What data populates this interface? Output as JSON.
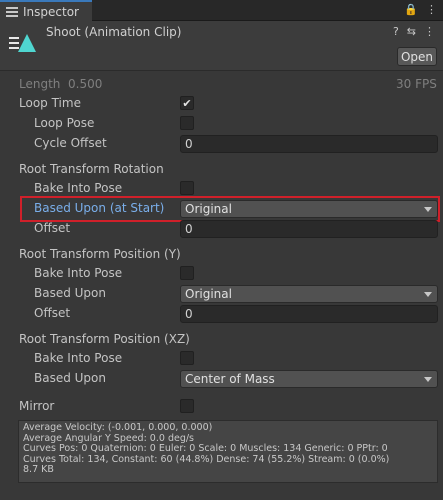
{
  "tab": {
    "label": "Inspector",
    "lock_glyph": "🔒",
    "menu_glyph": "⋮"
  },
  "header": {
    "title": "Shoot (Animation Clip)",
    "help_glyph": "?",
    "settings_glyph": "⇆",
    "menu_glyph": "⋮",
    "open_label": "Open"
  },
  "clip": {
    "length_label": "Length",
    "length_value": "0.500",
    "fps": "30 FPS"
  },
  "loop_time": {
    "label": "Loop Time",
    "checked": true,
    "check_glyph": "✔"
  },
  "loop_pose": {
    "label": "Loop Pose"
  },
  "cycle_offset": {
    "label": "Cycle Offset",
    "value": "0"
  },
  "root_rotation": {
    "section_label": "Root Transform Rotation",
    "bake_label": "Bake Into Pose",
    "based_upon_label": "Based Upon (at Start)",
    "based_upon_value": "Original",
    "offset_label": "Offset",
    "offset_value": "0"
  },
  "root_position_y": {
    "section_label": "Root Transform Position (Y)",
    "bake_label": "Bake Into Pose",
    "based_upon_label": "Based Upon",
    "based_upon_value": "Original",
    "offset_label": "Offset",
    "offset_value": "0"
  },
  "root_position_xz": {
    "section_label": "Root Transform Position (XZ)",
    "bake_label": "Bake Into Pose",
    "based_upon_label": "Based Upon",
    "based_upon_value": "Center of Mass"
  },
  "mirror": {
    "label": "Mirror"
  },
  "stats": {
    "line1": "Average Velocity: (-0.001, 0.000, 0.000)",
    "line2": "Average Angular Y Speed: 0.0 deg/s",
    "line3": "Curves Pos: 0 Quaternion: 0 Euler: 0 Scale: 0 Muscles: 134 Generic: 0 PPtr: 0",
    "line4": "Curves Total: 134, Constant: 60 (44.8%) Dense: 74 (55.2%) Stream: 0 (0.0%)",
    "line5": "8.7 KB"
  },
  "colors": {
    "panel_bg": "#383838",
    "highlight_border": "#d0202a",
    "tab_accent": "#3a79bb",
    "clip_icon": "#4fd6d0"
  }
}
